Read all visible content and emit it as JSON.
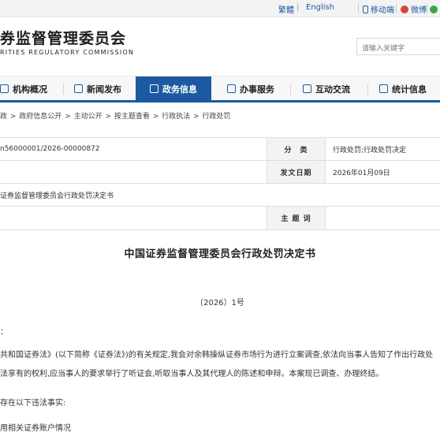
{
  "topbar": {
    "lang_tc": "繁體",
    "lang_sep": "|",
    "lang_en": "English",
    "mobile": "移动端",
    "weibo": "微博",
    "wechat": "微"
  },
  "header": {
    "title_cn": "券监督管理委员会",
    "title_en": "RITIES REGULATORY COMMISSION",
    "search_placeholder": "请输入关键字"
  },
  "nav": {
    "items": [
      {
        "label": "机构概况"
      },
      {
        "label": "新闻发布"
      },
      {
        "label": "政务信息"
      },
      {
        "label": "办事服务"
      },
      {
        "label": "互动交流"
      },
      {
        "label": "统计信息"
      }
    ],
    "active_index": 2
  },
  "breadcrumb": {
    "items": [
      "政",
      "政府信息公开",
      "主动公开",
      "按主题查看",
      "行政执法",
      "行政处罚"
    ],
    "separator": " > "
  },
  "meta": {
    "index_no": "n56000001/2026-00000872",
    "category_label": "分　类",
    "category_value": "行政处罚;行政处罚决定",
    "title_value": "证券监督管理委员会行政处罚决定书",
    "date_label": "发文日期",
    "date_value": "2026年01月09日",
    "subject_label": "主 题 词",
    "subject_value": ""
  },
  "document": {
    "title": "中国证券监督管理委员会行政处罚决定书",
    "doc_no": "〔2026〕1号",
    "para_mark": "：",
    "para1": "共和国证券法》(以下简称《证券法》)的有关规定,我会对余韩操纵证券市场行为进行立案调查,依法向当事人告知了作出行政处",
    "para2": "法享有的权利,应当事人的要求举行了听证会,听取当事人及其代理人的陈述和申辩。本案现已调查、办理终结。",
    "para3": "存在以下违法事实:",
    "para4": "用相关证券账户情况"
  },
  "colors": {
    "nav_active": "#1b5aa0",
    "link": "#1f5aa6"
  }
}
